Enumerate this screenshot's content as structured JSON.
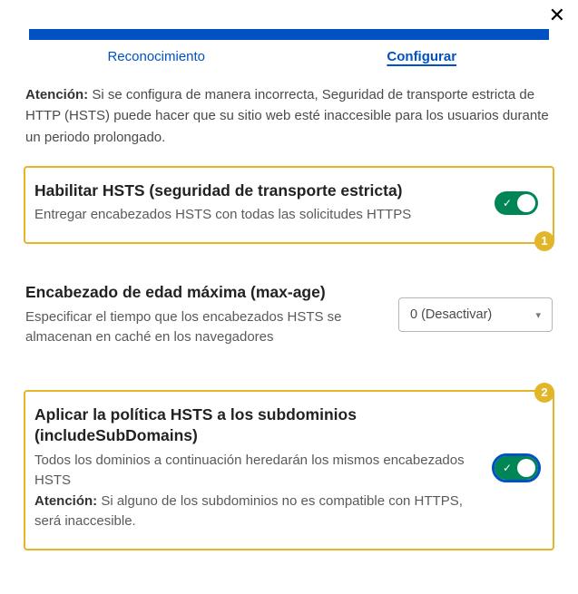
{
  "close_symbol": "✕",
  "tabs": {
    "recognition": "Reconocimiento",
    "configure": "Configurar"
  },
  "warning": {
    "label": "Atención:",
    "text": " Si se configura de manera incorrecta, Seguridad de transporte estricta de HTTP (HSTS) puede hacer que su sitio web esté inaccesible para los usuarios durante un periodo prolongado."
  },
  "sections": {
    "enable": {
      "title": "Habilitar HSTS (seguridad de transporte estricta)",
      "desc": "Entregar encabezados HSTS con todas las solicitudes HTTPS",
      "badge": "1",
      "toggle_check": "✓"
    },
    "maxage": {
      "title": "Encabezado de edad máxima (max-age)",
      "desc": "Especificar el tiempo que los encabezados HSTS se almacenan en caché en los navegadores",
      "select_value": "0 (Desactivar)",
      "caret": "▾"
    },
    "subdomains": {
      "title": "Aplicar la política HSTS a los subdominios (includeSubDomains)",
      "desc1": "Todos los dominios a continuación heredarán los mismos encabezados HSTS",
      "warn_label": "Atención:",
      "warn_text": " Si alguno de los subdominios no es compatible con HTTPS, será inaccesible.",
      "badge": "2",
      "toggle_check": "✓"
    }
  }
}
